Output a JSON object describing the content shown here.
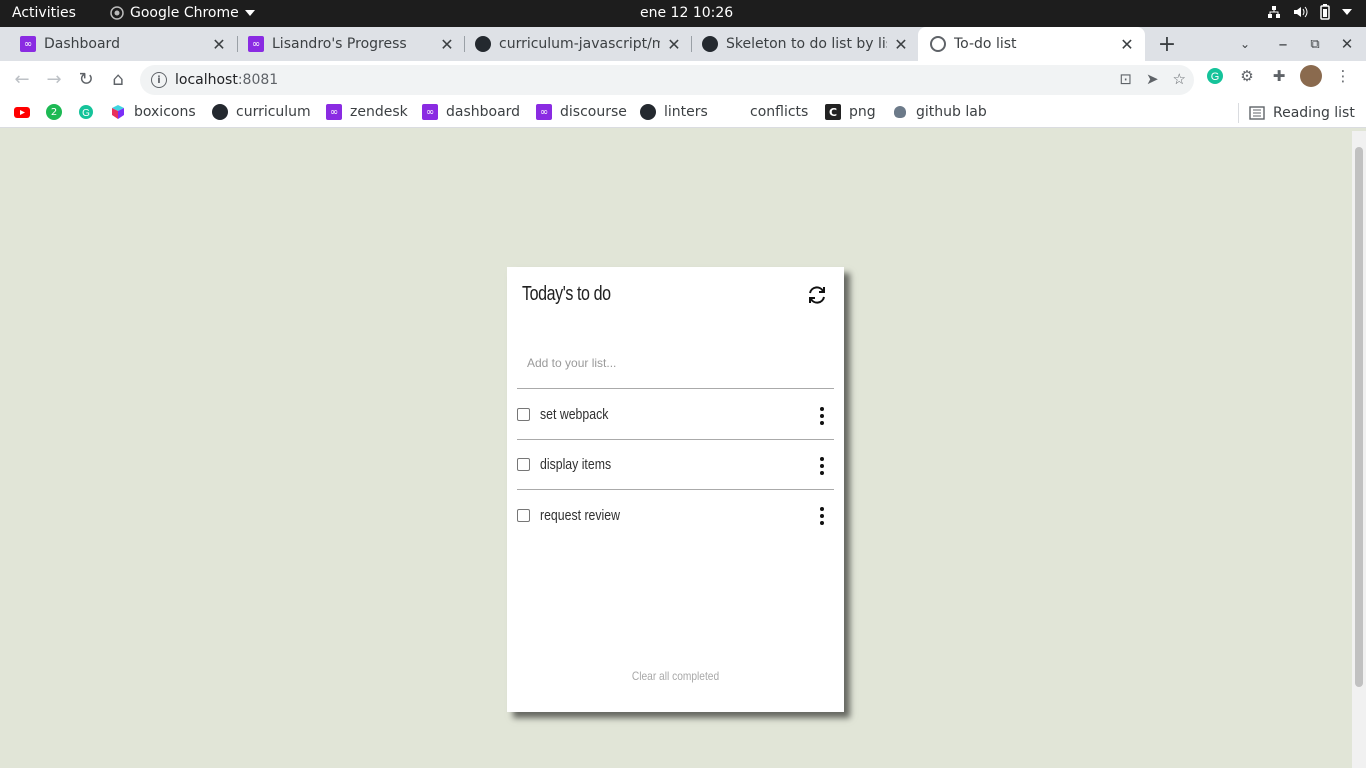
{
  "system_bar": {
    "activities": "Activities",
    "app_name": "Google Chrome",
    "clock": "ene 12  10:26"
  },
  "tabs": [
    {
      "title": "Dashboard",
      "favicon": "zendesk-purple-icon"
    },
    {
      "title": "Lisandro's Progress",
      "favicon": "zendesk-purple-icon"
    },
    {
      "title": "curriculum-javascript/m",
      "favicon": "github-icon"
    },
    {
      "title": "Skeleton to do list by lis",
      "favicon": "github-icon"
    },
    {
      "title": "To-do list",
      "favicon": "globe-icon",
      "active": true
    }
  ],
  "omnibox": {
    "host": "localhost",
    "port": ":8081"
  },
  "bookmarks": [
    {
      "label": "",
      "icon": "youtube-icon"
    },
    {
      "label": "",
      "icon": "badge-2-icon",
      "badge": "2"
    },
    {
      "label": "",
      "icon": "grammarly-icon"
    },
    {
      "label": "boxicons",
      "icon": "boxicons-icon"
    },
    {
      "label": "curriculum",
      "icon": "github-icon"
    },
    {
      "label": "zendesk",
      "icon": "zendesk-purple-icon"
    },
    {
      "label": "dashboard",
      "icon": "zendesk-purple-icon"
    },
    {
      "label": "discourse",
      "icon": "zendesk-purple-icon"
    },
    {
      "label": "linters",
      "icon": "github-icon"
    },
    {
      "label": "conflicts",
      "icon": "none"
    },
    {
      "label": "png",
      "icon": "png-icon"
    },
    {
      "label": "github lab",
      "icon": "github-lab-icon"
    }
  ],
  "reading_list": "Reading list",
  "todo": {
    "title": "Today's to do",
    "input_placeholder": "Add to your list...",
    "items": [
      {
        "description": "set webpack",
        "completed": false
      },
      {
        "description": "display items",
        "completed": false
      },
      {
        "description": "request review",
        "completed": false
      }
    ],
    "clear_label": "Clear all completed"
  }
}
